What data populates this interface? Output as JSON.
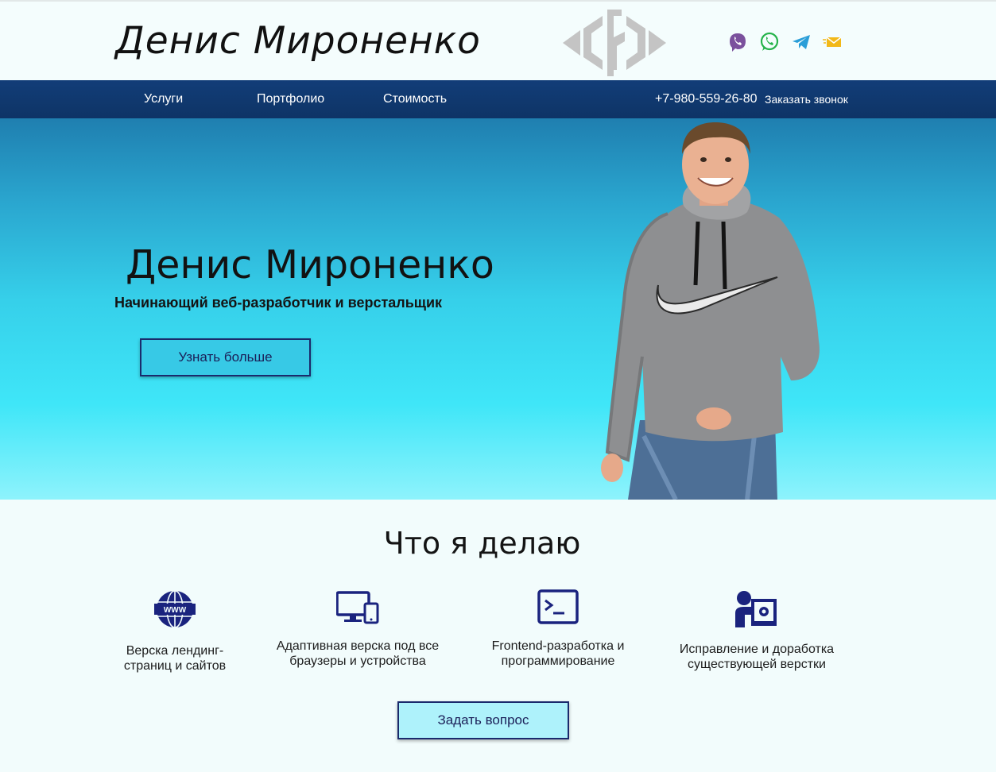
{
  "header": {
    "brand": "Денис Мироненко",
    "logo_icon": "code-brackets-logo",
    "social": [
      "viber-icon",
      "whatsapp-icon",
      "telegram-icon",
      "email-icon"
    ]
  },
  "nav": {
    "items": [
      "Услуги",
      "Портфолио",
      "Стоимость"
    ],
    "phone": "+7-980-559-26-80",
    "callback": "Заказать звонок"
  },
  "hero": {
    "name": "Денис Мироненко",
    "subtitle": "Начинающий веб-разработчик и верстальщик",
    "button": "Узнать больше"
  },
  "services": {
    "title": "Что я делаю",
    "items": [
      {
        "line1": "Верска лендинг-",
        "line2": "страниц и сайтов",
        "icon": "globe-icon"
      },
      {
        "line1": "Адаптивная верска под все",
        "line2": "браузеры и устройства",
        "icon": "devices-icon"
      },
      {
        "line1": "Frontend-разработка и",
        "line2": "программирование",
        "icon": "terminal-icon"
      },
      {
        "line1": "Исправление и доработка",
        "line2": "существующей верстки",
        "icon": "developer-icon"
      }
    ],
    "button": "Задать вопрос"
  },
  "colors": {
    "nav": "#123d78",
    "accent_dark": "#1a2a6c",
    "hero_top": "#1f7fb0",
    "hero_bottom": "#8ef3fc",
    "icon_color": "#1a237e"
  }
}
